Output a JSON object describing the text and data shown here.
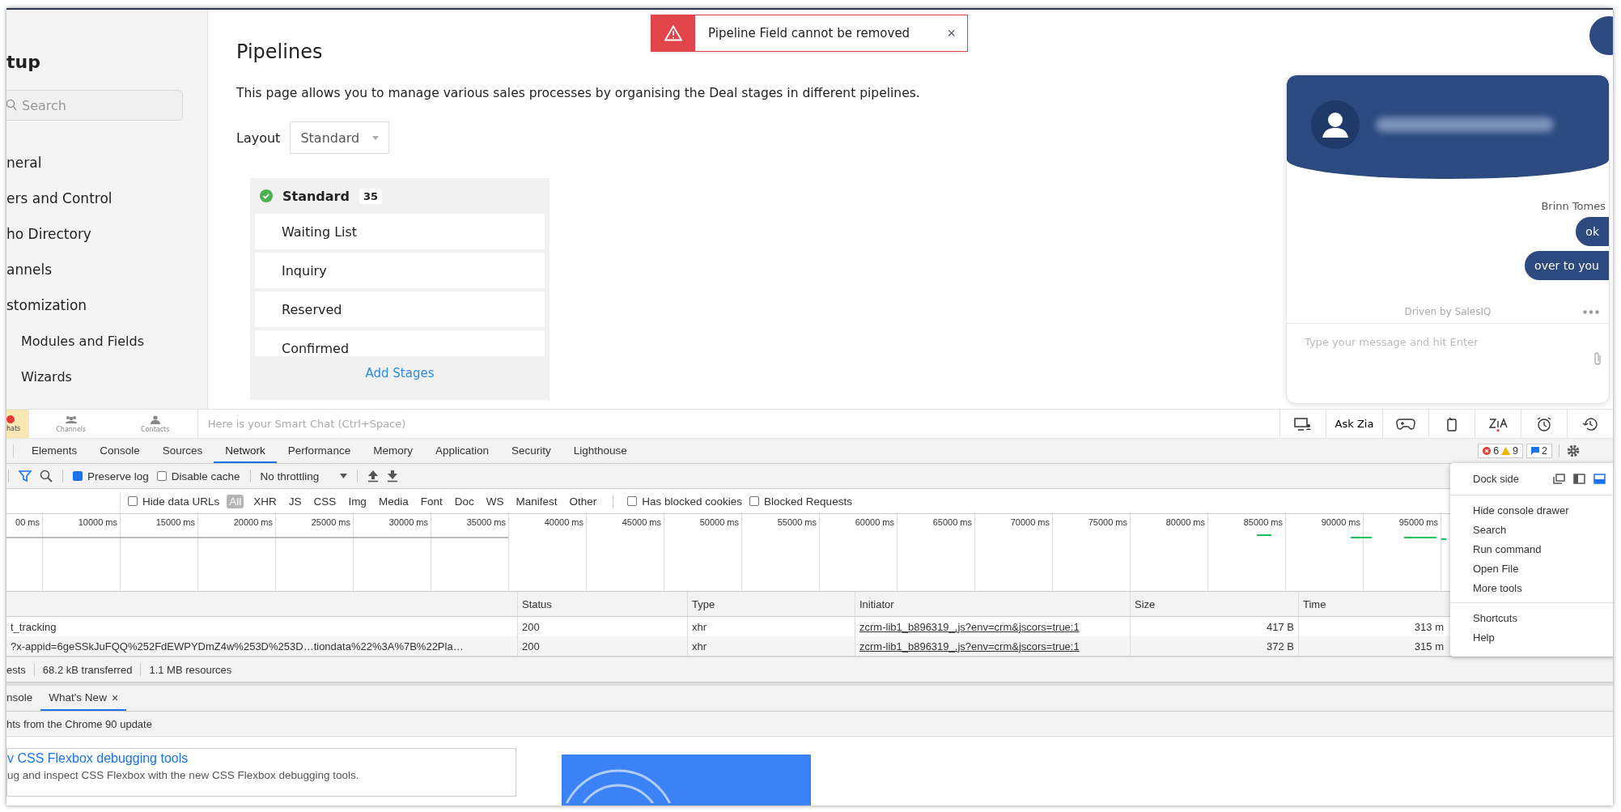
{
  "sidebar": {
    "title": "tup",
    "search": {
      "placeholder": "Search"
    },
    "items": [
      {
        "label": "neral"
      },
      {
        "label": "ers and Control"
      },
      {
        "label": "ho Directory"
      },
      {
        "label": "annels"
      },
      {
        "label": "stomization",
        "children": [
          {
            "label": "Modules and Fields"
          },
          {
            "label": "Wizards"
          }
        ]
      }
    ]
  },
  "main": {
    "title": "Pipelines",
    "description": "This page allows you to manage various sales processes by organising the Deal stages in different pipelines.",
    "layout": {
      "label": "Layout",
      "value": "Standard"
    },
    "pipeline": {
      "name": "Standard",
      "count": "35",
      "stages": [
        "Waiting List",
        "Inquiry",
        "Reserved",
        "Confirmed"
      ],
      "add": "Add Stages"
    }
  },
  "toast": {
    "message": "Pipeline Field cannot be removed",
    "close": "×"
  },
  "chat": {
    "sender": "Brinn Tomes",
    "messages": [
      "ok",
      "over to you"
    ],
    "branding": "Driven by SalesIQ",
    "input": {
      "placeholder": "Type your message and hit Enter"
    }
  },
  "bottom_bar": {
    "items": [
      {
        "label": "hats",
        "kind": "chats",
        "selected": true
      },
      {
        "label": "Channels",
        "kind": "channels",
        "selected": false
      },
      {
        "label": "Contacts",
        "kind": "contacts",
        "selected": false
      }
    ],
    "smart_chat": {
      "placeholder": "Here is your Smart Chat (Ctrl+Space)"
    },
    "ask": "Ask Zia"
  },
  "devtools": {
    "tabs": [
      {
        "label": "Elements",
        "selected": false
      },
      {
        "label": "Console",
        "selected": false
      },
      {
        "label": "Sources",
        "selected": false
      },
      {
        "label": "Network",
        "selected": true
      },
      {
        "label": "Performance",
        "selected": false
      },
      {
        "label": "Memory",
        "selected": false
      },
      {
        "label": "Application",
        "selected": false
      },
      {
        "label": "Security",
        "selected": false
      },
      {
        "label": "Lighthouse",
        "selected": false
      }
    ],
    "counts": {
      "errors": "6",
      "warnings": "9",
      "messages": "2"
    },
    "toolbar": {
      "preserve_log": {
        "label": "Preserve log",
        "checked": true
      },
      "disable_cache": {
        "label": "Disable cache",
        "checked": false
      },
      "throttling": "No throttling"
    },
    "filters": {
      "hide_data_urls": {
        "label": "Hide data URLs",
        "checked": false
      },
      "types": [
        {
          "label": "All",
          "selected": true
        },
        {
          "label": "XHR",
          "selected": false
        },
        {
          "label": "JS",
          "selected": false
        },
        {
          "label": "CSS",
          "selected": false
        },
        {
          "label": "Img",
          "selected": false
        },
        {
          "label": "Media",
          "selected": false
        },
        {
          "label": "Font",
          "selected": false
        },
        {
          "label": "Doc",
          "selected": false
        },
        {
          "label": "WS",
          "selected": false
        },
        {
          "label": "Manifest",
          "selected": false
        },
        {
          "label": "Other",
          "selected": false
        }
      ],
      "has_blocked_cookies": {
        "label": "Has blocked cookies",
        "checked": false
      },
      "blocked_requests": {
        "label": "Blocked Requests",
        "checked": false
      }
    },
    "timeline": {
      "ticks": [
        "00 ms",
        "10000 ms",
        "15000 ms",
        "20000 ms",
        "25000 ms",
        "30000 ms",
        "35000 ms",
        "40000 ms",
        "45000 ms",
        "50000 ms",
        "55000 ms",
        "60000 ms",
        "65000 ms",
        "70000 ms",
        "75000 ms",
        "80000 ms",
        "85000 ms",
        "90000 ms",
        "95000 ms"
      ]
    },
    "table": {
      "columns": [
        "Status",
        "Type",
        "Initiator",
        "Size",
        "Time"
      ],
      "rows": [
        {
          "name": "t_tracking",
          "status": "200",
          "type": "xhr",
          "initiator": "zcrm-lib1_b896319_.js?env=crm&jscors=true:1",
          "size": "417 B",
          "time": "313 m"
        },
        {
          "name": "?x-appid=6geSSkJuFQQ%252FdEWPYDmZ4w%253D%253D…tiondata%22%3A%7B%22Pla…",
          "status": "200",
          "type": "xhr",
          "initiator": "zcrm-lib1_b896319_.js?env=crm&jscors=true:1",
          "size": "372 B",
          "time": "315 m"
        }
      ]
    },
    "summary": [
      "ests",
      "68.2 kB transferred",
      "1.1 MB resources"
    ],
    "drawer": {
      "tabs": [
        {
          "label": "nsole",
          "selected": false,
          "closable": false
        },
        {
          "label": "What's New",
          "selected": true,
          "closable": true
        }
      ],
      "close": "×",
      "subtitle": "hts from the Chrome 90 update",
      "article": {
        "title": "v CSS Flexbox debugging tools",
        "description": "ug and inspect CSS Flexbox with the new CSS Flexbox debugging tools."
      }
    },
    "menu": {
      "dock_label": "Dock side",
      "dock_options": [
        {
          "kind": "undock",
          "selected": false
        },
        {
          "kind": "left",
          "selected": false
        },
        {
          "kind": "bottom",
          "selected": true
        }
      ],
      "groups": [
        [
          "Hide console drawer",
          "Search",
          "Run command",
          "Open File",
          "More tools"
        ],
        [
          "Shortcuts",
          "Help"
        ]
      ]
    }
  }
}
